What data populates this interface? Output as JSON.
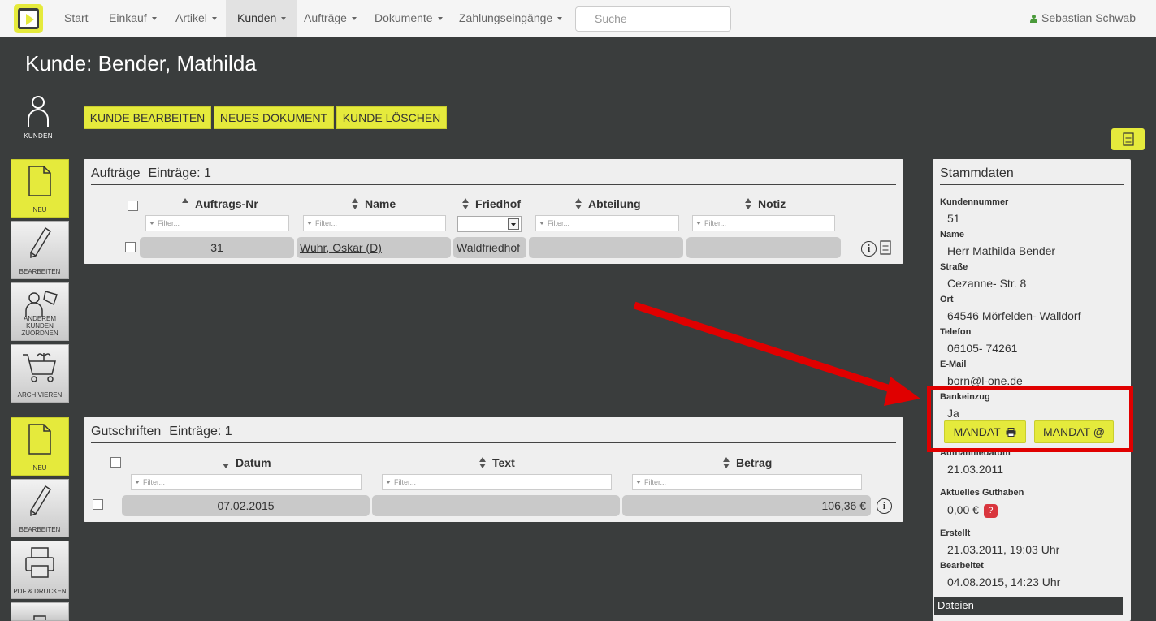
{
  "nav": {
    "items": [
      {
        "label": "Start",
        "caret": false
      },
      {
        "label": "Einkauf",
        "caret": true
      },
      {
        "label": "Artikel",
        "caret": true
      },
      {
        "label": "Kunden",
        "caret": true
      },
      {
        "label": "Aufträge",
        "caret": true
      },
      {
        "label": "Dokumente",
        "caret": true
      },
      {
        "label": "Zahlungseingänge",
        "caret": true
      }
    ],
    "active": "Kunden",
    "search_placeholder": "Suche",
    "user": "Sebastian Schwab"
  },
  "page": {
    "title": "Kunde: Bender, Mathilda"
  },
  "sidebar": {
    "kunden_label": "KUNDEN",
    "group1": [
      "NEU",
      "BEARBEITEN",
      "ANDEREM KUNDEN ZUORDNEN",
      "ARCHIVIEREN"
    ],
    "group2": [
      "NEU",
      "BEARBEITEN",
      "PDF & DRUCKEN"
    ]
  },
  "actions": [
    "KUNDE BEARBEITEN",
    "NEUES DOKUMENT",
    "KUNDE LÖSCHEN"
  ],
  "auftraege": {
    "title": "Aufträge",
    "count": "Einträge: 1",
    "columns": [
      "Auftrags-Nr",
      "Name",
      "Friedhof",
      "Abteilung",
      "Notiz"
    ],
    "filter_placeholder": "Filter...",
    "rows": [
      {
        "nr": "31",
        "name": "Wuhr, Oskar (D)",
        "friedhof": "Waldfriedhof",
        "abteilung": "",
        "notiz": ""
      }
    ]
  },
  "gutschriften": {
    "title": "Gutschriften",
    "count": "Einträge: 1",
    "columns": [
      "Datum",
      "Text",
      "Betrag"
    ],
    "filter_placeholder": "Filter...",
    "rows": [
      {
        "datum": "07.02.2015",
        "text": "",
        "betrag": "106,36 €"
      }
    ]
  },
  "stammdaten": {
    "title": "Stammdaten",
    "kundennummer_label": "Kundennummer",
    "kundennummer": "51",
    "name_label": "Name",
    "name": "Herr Mathilda Bender",
    "strasse_label": "Straße",
    "strasse": "Cezanne- Str. 8",
    "ort_label": "Ort",
    "ort": "64546 Mörfelden- Walldorf",
    "telefon_label": "Telefon",
    "telefon": "06105- 74261",
    "email_label": "E-Mail",
    "email": "born@l-one.de",
    "bankeinzug_label": "Bankeinzug",
    "bankeinzug": "Ja",
    "mandat_print": "MANDAT",
    "mandat_mail": "MANDAT @",
    "aufnahme_label": "Aufnahmedatum",
    "aufnahme": "21.03.2011",
    "guthaben_label": "Aktuelles Guthaben",
    "guthaben": "0,00 €",
    "guthaben_help": "?",
    "erstellt_label": "Erstellt",
    "erstellt": "21.03.2011, 19:03 Uhr",
    "bearbeitet_label": "Bearbeitet",
    "bearbeitet": "04.08.2015, 14:23 Uhr",
    "dateien": "Dateien"
  },
  "colors": {
    "accent": "#e5ea3c",
    "background": "#3a3d3d",
    "annotation": "#e00000"
  }
}
